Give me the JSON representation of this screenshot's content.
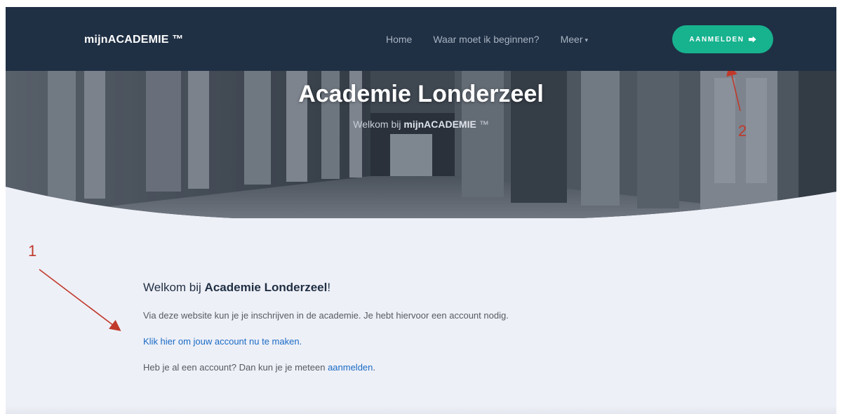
{
  "navbar": {
    "brand": "mijnACADEMIE ™",
    "links": [
      {
        "label": "Home"
      },
      {
        "label": "Waar moet ik beginnen?"
      },
      {
        "label": "Meer",
        "caret": "▾"
      }
    ],
    "login_button": {
      "label": "AANMELDEN",
      "icon": "sign-in-icon"
    }
  },
  "hero": {
    "title": "Academie Londerzeel",
    "subtitle_prefix": "Welkom bij ",
    "subtitle_brand": "mijnACADEMIE",
    "subtitle_suffix": " ™",
    "background": "hallway-photo"
  },
  "content": {
    "welcome_prefix": "Welkom bij ",
    "welcome_bold": "Academie Londerzeel",
    "welcome_suffix": "!",
    "intro": "Via deze website kun je je inschrijven in de academie. Je hebt hiervoor een account nodig.",
    "create_account_link": "Klik hier om jouw account nu te maken.",
    "have_account_prefix": "Heb je al een account? Dan kun je je meteen ",
    "login_link": "aanmelden",
    "have_account_suffix": "."
  },
  "annotations": {
    "arrow_1_label": "1",
    "arrow_2_label": "2",
    "color": "#c0392b"
  },
  "colors": {
    "navbar_bg": "#1f2f44",
    "accent": "#17b28e",
    "link": "#1a6bc6",
    "page_bg": "#eef0f7"
  }
}
